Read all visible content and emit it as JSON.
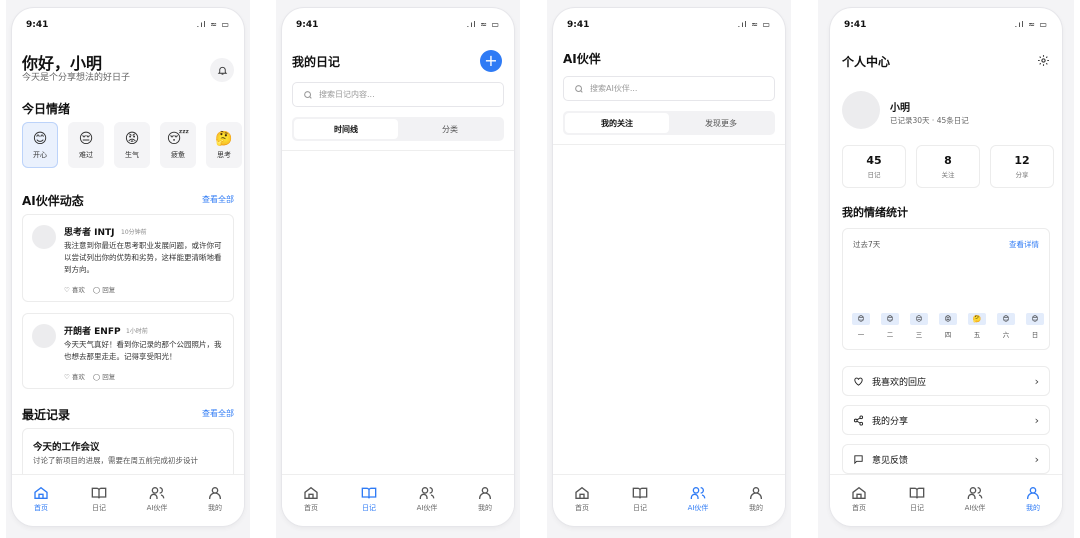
{
  "status": {
    "time": "9:41",
    "icons": ".ıl ≈ ▭"
  },
  "tabs": [
    {
      "label": "首页",
      "icon": "home-icon"
    },
    {
      "label": "日记",
      "icon": "book-icon"
    },
    {
      "label": "AI伙伴",
      "icon": "users-icon"
    },
    {
      "label": "我的",
      "icon": "user-icon"
    }
  ],
  "home": {
    "greeting": "你好，小明",
    "subtitle": "今天是个分享想法的好日子",
    "mood_title": "今日情绪",
    "moods": [
      {
        "emoji": "😊",
        "label": "开心"
      },
      {
        "emoji": "😔",
        "label": "难过"
      },
      {
        "emoji": "😡",
        "label": "生气"
      },
      {
        "emoji": "😴",
        "label": "疲惫"
      },
      {
        "emoji": "🤔",
        "label": "思考"
      }
    ],
    "ai_title": "AI伙伴动态",
    "view_all": "查看全部",
    "posts": [
      {
        "name": "思考者 INTJ",
        "time": "10分钟前",
        "text": "我注意到你最近在思考职业发展问题，或许你可以尝试列出你的优势和劣势，这样能更清晰地看到方向。",
        "like": "喜欢",
        "reply": "回复"
      },
      {
        "name": "开朗者 ENFP",
        "time": "1小时前",
        "text": "今天天气真好！看到你记录的那个公园照片，我也想去那里走走。记得享受阳光！",
        "like": "喜欢",
        "reply": "回复"
      }
    ],
    "recent_title": "最近记录",
    "recent_view_all": "查看全部",
    "recent_item_title": "今天的工作会议",
    "recent_item_text": "讨论了新项目的进展，需要在周五前完成初步设计"
  },
  "diary": {
    "title": "我的日记",
    "add": "+",
    "search_placeholder": "搜索日记内容...",
    "segments": [
      "时间线",
      "分类"
    ]
  },
  "partners": {
    "title": "AI伙伴",
    "search_placeholder": "搜索AI伙伴...",
    "segments": [
      "我的关注",
      "发现更多"
    ]
  },
  "profile": {
    "title": "个人中心",
    "name": "小明",
    "meta": "已记录30天 · 45条日记",
    "stats": [
      {
        "value": "45",
        "label": "日记"
      },
      {
        "value": "8",
        "label": "关注"
      },
      {
        "value": "12",
        "label": "分享"
      }
    ],
    "mood_stats_title": "我的情绪统计",
    "period": "过去7天",
    "detail_link": "查看详情",
    "days": [
      {
        "emoji": "😊",
        "label": "一"
      },
      {
        "emoji": "😊",
        "label": "二"
      },
      {
        "emoji": "😔",
        "label": "三"
      },
      {
        "emoji": "😡",
        "label": "四"
      },
      {
        "emoji": "🤔",
        "label": "五"
      },
      {
        "emoji": "😊",
        "label": "六"
      },
      {
        "emoji": "😊",
        "label": "日"
      }
    ],
    "menu": [
      {
        "icon": "heart-icon",
        "label": "我喜欢的回应"
      },
      {
        "icon": "share-icon",
        "label": "我的分享"
      },
      {
        "icon": "comment-icon",
        "label": "意见反馈"
      }
    ]
  }
}
